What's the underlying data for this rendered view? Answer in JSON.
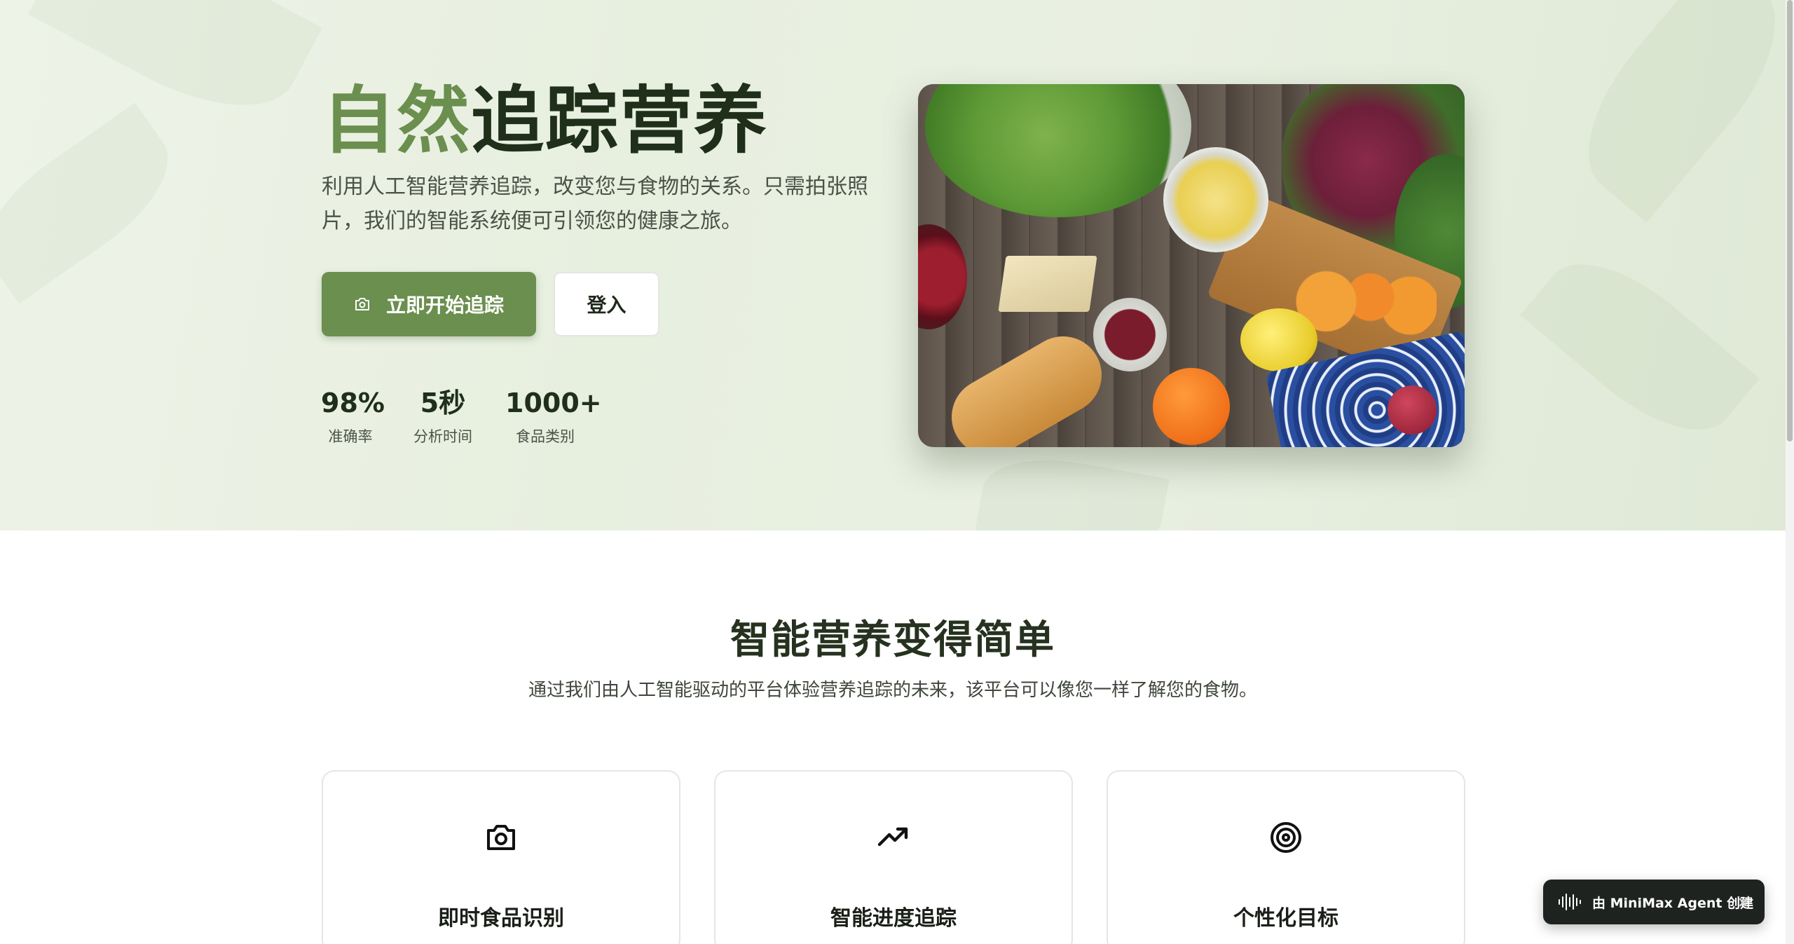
{
  "hero": {
    "title_accent": "自然",
    "title_rest": "追踪营养",
    "subtitle": "利用人工智能营养追踪，改变您与食物的关系。只需拍张照片，我们的智能系统便可引领您的健康之旅。",
    "primary_button": "立即开始追踪",
    "secondary_button": "登入",
    "stats": [
      {
        "value": "98%",
        "label": "准确率"
      },
      {
        "value": "5秒",
        "label": "分析时间"
      },
      {
        "value": "1000+",
        "label": "食品类别"
      }
    ]
  },
  "features": {
    "title": "智能营养变得简单",
    "subtitle": "通过我们由人工智能驱动的平台体验营养追踪的未来，该平台可以像您一样了解您的食物。",
    "cards": [
      {
        "icon": "camera-icon",
        "title": "即时食品识别"
      },
      {
        "icon": "trending-up-icon",
        "title": "智能进度追踪"
      },
      {
        "icon": "target-icon",
        "title": "个性化目标"
      }
    ]
  },
  "badge": {
    "text": "由 MiniMax Agent 创建",
    "close": "×"
  },
  "colors": {
    "accent": "#6b8f4e",
    "dark_text": "#1f2f1a",
    "badge_bg": "#1f2320"
  }
}
